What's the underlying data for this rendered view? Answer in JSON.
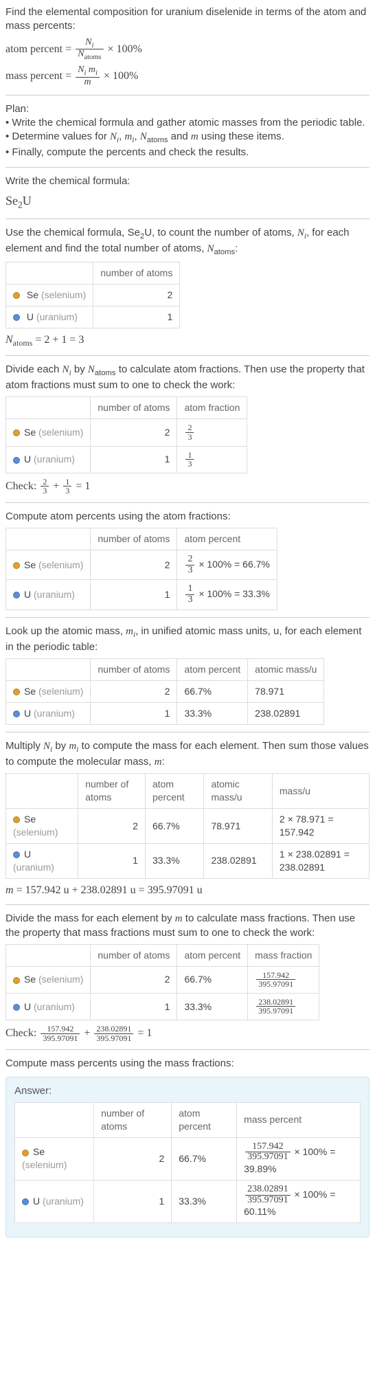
{
  "intro": {
    "line1": "Find the elemental composition for uranium diselenide in terms of the atom and mass percents:",
    "atom_label": "atom percent =",
    "atom_frac_num": "N_i",
    "atom_frac_den": "N_atoms",
    "times100a": " × 100%",
    "mass_label": "mass percent =",
    "mass_frac_num": "N_i m_i",
    "mass_frac_den": "m",
    "times100b": " × 100%"
  },
  "plan": {
    "title": "Plan:",
    "b1": "• Write the chemical formula and gather atomic masses from the periodic table.",
    "b2_a": "• Determine values for ",
    "b2_b": " using these items.",
    "vars": "N_i, m_i, N_atoms and m",
    "b3": "• Finally, compute the percents and check the results."
  },
  "write": {
    "title": "Write the chemical formula:",
    "formula": "Se₂U"
  },
  "count": {
    "text_a": "Use the chemical formula, Se",
    "text_b": "U, to count the number of atoms, ",
    "text_c": ", for each element and find the total number of atoms, ",
    "text_d": ":",
    "sub2": "2",
    "Ni": "N_i",
    "Natoms": "N_atoms",
    "hdr_num": "number of atoms",
    "sum": "N_atoms = 2 + 1 = 3"
  },
  "elements": {
    "se": {
      "color": "#e0a030",
      "sym": "Se",
      "name": "(selenium)"
    },
    "u": {
      "color": "#5a8fd6",
      "sym": "U",
      "name": "(uranium)"
    }
  },
  "atomfrac": {
    "text": "Divide each N_i by N_atoms to calculate atom fractions. Then use the property that atom fractions must sum to one to check the work:",
    "hdr_num": "number of atoms",
    "hdr_frac": "atom fraction",
    "se_n": "2",
    "se_num": "2",
    "se_den": "3",
    "u_n": "1",
    "u_num": "1",
    "u_den": "3",
    "check": "Check: 2/3 + 1/3 = 1"
  },
  "atompct": {
    "text": "Compute atom percents using the atom fractions:",
    "hdr_num": "number of atoms",
    "hdr_pct": "atom percent",
    "se_n": "2",
    "se_frac_num": "2",
    "se_frac_den": "3",
    "se_expr": " × 100% = 66.7%",
    "u_n": "1",
    "u_frac_num": "1",
    "u_frac_den": "3",
    "u_expr": " × 100% = 33.3%"
  },
  "amu": {
    "text": "Look up the atomic mass, m_i, in unified atomic mass units, u, for each element in the periodic table:",
    "hdr_num": "number of atoms",
    "hdr_pct": "atom percent",
    "hdr_mass": "atomic mass/u",
    "se_n": "2",
    "se_pct": "66.7%",
    "se_mass": "78.971",
    "u_n": "1",
    "u_pct": "33.3%",
    "u_mass": "238.02891"
  },
  "massmul": {
    "text": "Multiply N_i by m_i to compute the mass for each element. Then sum those values to compute the molecular mass, m:",
    "hdr_num": "number of atoms",
    "hdr_pct": "atom percent",
    "hdr_amu": "atomic mass/u",
    "hdr_mu": "mass/u",
    "se_n": "2",
    "se_pct": "66.7%",
    "se_amu": "78.971",
    "se_mu": "2 × 78.971 = 157.942",
    "u_n": "1",
    "u_pct": "33.3%",
    "u_amu": "238.02891",
    "u_mu": "1 × 238.02891 = 238.02891",
    "sum": "m = 157.942 u + 238.02891 u = 395.97091 u"
  },
  "massfrac": {
    "text": "Divide the mass for each element by m to calculate mass fractions. Then use the property that mass fractions must sum to one to check the work:",
    "hdr_num": "number of atoms",
    "hdr_pct": "atom percent",
    "hdr_mf": "mass fraction",
    "se_n": "2",
    "se_pct": "66.7%",
    "se_num": "157.942",
    "se_den": "395.97091",
    "u_n": "1",
    "u_pct": "33.3%",
    "u_num": "238.02891",
    "u_den": "395.97091",
    "check_a": "Check: ",
    "check_b": " + ",
    "check_c": " = 1"
  },
  "masspct": {
    "text": "Compute mass percents using the mass fractions:"
  },
  "answer": {
    "title": "Answer:",
    "hdr_num": "number of atoms",
    "hdr_pct": "atom percent",
    "hdr_mp": "mass percent",
    "se_n": "2",
    "se_pct": "66.7%",
    "se_num": "157.942",
    "se_den": "395.97091",
    "se_tail": " × 100% = 39.89%",
    "u_n": "1",
    "u_pct": "33.3%",
    "u_num": "238.02891",
    "u_den": "395.97091",
    "u_tail": " × 100% = 60.11%"
  },
  "chart_data": {
    "type": "table",
    "title": "Elemental composition of uranium diselenide (Se2U)",
    "elements": [
      {
        "symbol": "Se",
        "name": "selenium",
        "atoms": 2,
        "atom_percent": 66.7,
        "atomic_mass_u": 78.971,
        "mass_u": 157.942,
        "mass_fraction": 0.39887,
        "mass_percent": 39.89
      },
      {
        "symbol": "U",
        "name": "uranium",
        "atoms": 1,
        "atom_percent": 33.3,
        "atomic_mass_u": 238.02891,
        "mass_u": 238.02891,
        "mass_fraction": 0.60113,
        "mass_percent": 60.11
      }
    ],
    "N_atoms": 3,
    "molecular_mass_u": 395.97091
  }
}
